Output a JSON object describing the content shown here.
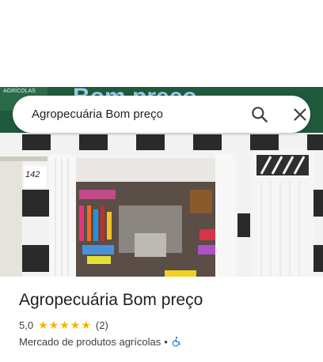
{
  "search": {
    "value": "Agropecuária Bom preço",
    "search_icon": "search-icon",
    "close_icon": "close-icon"
  },
  "hero": {
    "sign_text": "Bom preço",
    "sign_small_text": "AGRÍCOLAS",
    "house_number": "142"
  },
  "place": {
    "title": "Agropecuária Bom preço",
    "rating": "5,0",
    "stars": 5,
    "review_count": "(2)",
    "category": "Mercado de produtos agrícolas",
    "separator": "•",
    "accessibility_icon": "wheelchair-icon"
  },
  "colors": {
    "star": "#f4b400",
    "accessibility": "#1a73e8",
    "sign_green": "#1f5a3c"
  }
}
